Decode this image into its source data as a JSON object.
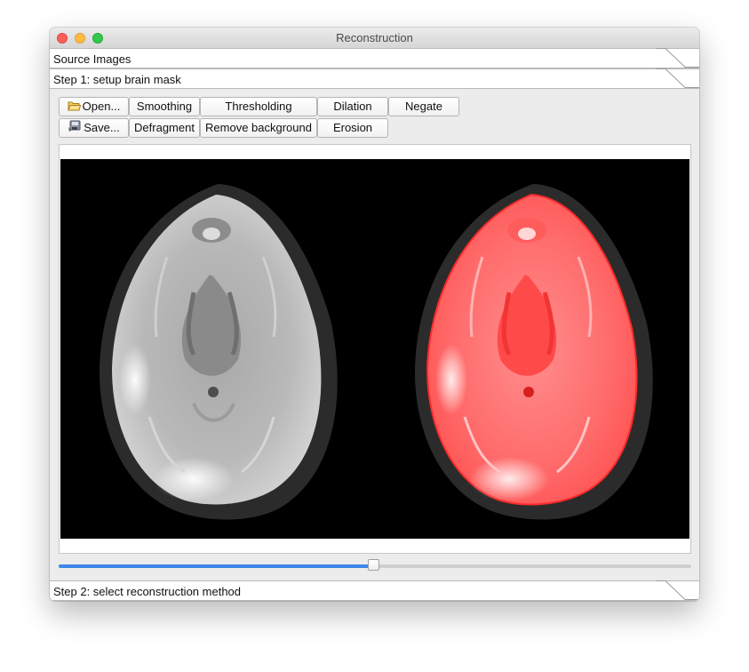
{
  "window": {
    "title": "Reconstruction"
  },
  "sections": {
    "source_images": "Source Images",
    "step1": "Step 1: setup brain mask",
    "step2": "Step 2: select reconstruction method"
  },
  "toolbar": {
    "open": "Open...",
    "save": "Save...",
    "smoothing": "Smoothing",
    "defragment": "Defragment",
    "thresholding": "Thresholding",
    "remove_background": "Remove background",
    "dilation": "Dilation",
    "erosion": "Erosion",
    "negate": "Negate"
  },
  "icons": {
    "open": "folder-icon",
    "save": "save-icon"
  },
  "viewer": {
    "panels": [
      "brain-slice-grayscale",
      "brain-slice-mask-overlay"
    ],
    "mask_color": "#ff3b3b"
  },
  "slider": {
    "fraction": 0.497
  },
  "colors": {
    "accent": "#3d87e8"
  }
}
